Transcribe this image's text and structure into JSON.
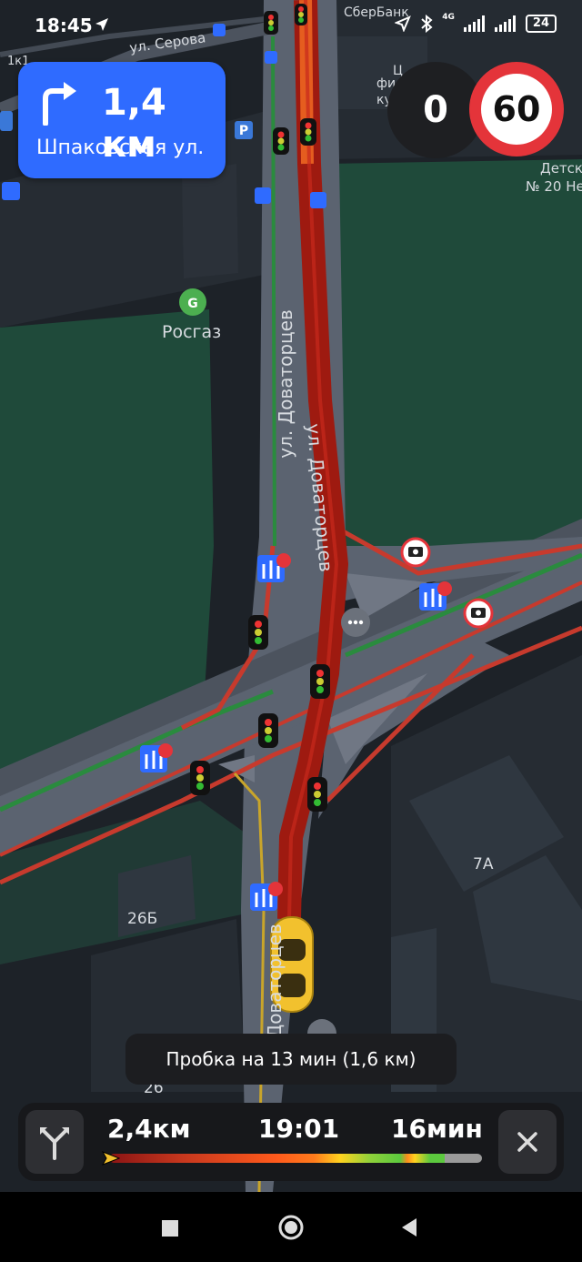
{
  "status_bar": {
    "time": "18:45",
    "network_1": "4G",
    "battery": "24"
  },
  "maneuver": {
    "distance": "1,4 км",
    "street": "Шпаковская ул."
  },
  "speed": {
    "current": "0",
    "limit": "60"
  },
  "map_labels": {
    "street_serova": "ул. Серова",
    "building_1k1": "1к1",
    "sberbank": "СберБанк",
    "rosgaz": "Росгаз",
    "street_dovatortsev_left": "ул. Доваторцев",
    "street_dovatortsev_route": "ул. Доваторцев",
    "street_dovatortsev_bottom": "ул. Доваторцев",
    "building_7a": "7А",
    "building_26b": "26Б",
    "building_26": "26",
    "detsad": "Детск",
    "detsad_num": "№ 20 Не",
    "fin": "фи",
    "ku": "ку",
    "tse": "Ц"
  },
  "traffic_toast": "Пробка на 13 мин (1,6 км)",
  "route": {
    "remaining_distance": "2,4км",
    "eta": "19:01",
    "remaining_time": "16мин"
  },
  "icons": {
    "maneuver": "turn-right-icon",
    "overview": "route-overview-icon",
    "close": "close-icon",
    "camera": "speed-camera-icon",
    "traffic_light": "traffic-light-icon",
    "lane_sign": "lane-sign-icon",
    "bus_stop": "bus-stop-icon",
    "parking": "parking-icon",
    "gas": "gas-station-icon",
    "comment": "road-comment-icon"
  },
  "colors": {
    "accent": "#2f6bff",
    "route_jam": "#9e1a10",
    "speed_limit_ring": "#e4343a"
  }
}
